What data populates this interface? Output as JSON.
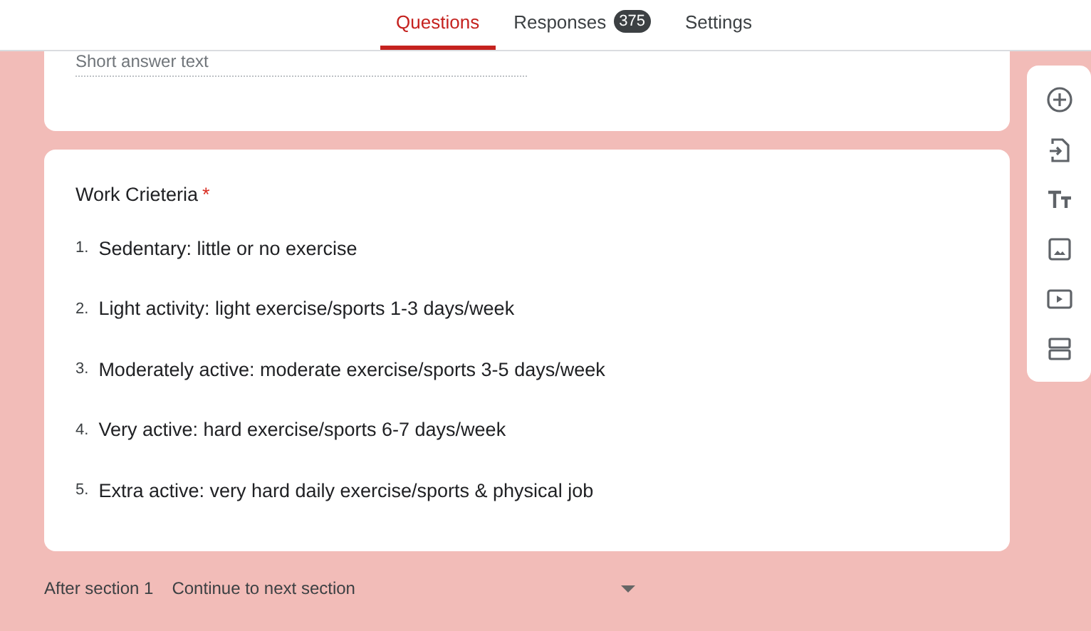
{
  "tabs": [
    {
      "label": "Questions",
      "selected": true
    },
    {
      "label": "Responses",
      "selected": false,
      "badge": "375"
    },
    {
      "label": "Settings",
      "selected": false
    }
  ],
  "previous_question": {
    "placeholder": "Short answer text"
  },
  "question": {
    "title": "Work Crieteria",
    "required_mark": "*",
    "options": [
      {
        "number": "1.",
        "label": "Sedentary: little or no exercise"
      },
      {
        "number": "2.",
        "label": "Light activity: light exercise/sports 1-3 days/week"
      },
      {
        "number": "3.",
        "label": "Moderately active: moderate exercise/sports 3-5 days/week"
      },
      {
        "number": "4.",
        "label": "Very active: hard exercise/sports 6-7 days/week"
      },
      {
        "number": "5.",
        "label": "Extra active: very hard daily exercise/sports & physical job"
      }
    ]
  },
  "toolbar": [
    {
      "kind": "add"
    },
    {
      "kind": "import"
    },
    {
      "kind": "title"
    },
    {
      "kind": "image"
    },
    {
      "kind": "video"
    },
    {
      "kind": "section"
    }
  ],
  "after_section": {
    "label": "After section 1",
    "value": "Continue to next section"
  }
}
